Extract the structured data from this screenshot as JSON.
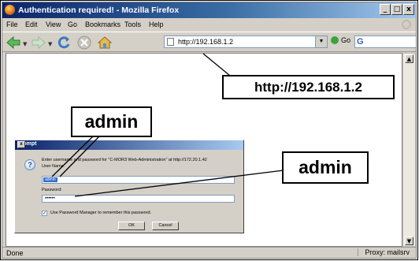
{
  "window": {
    "title": "Authentication required! - Mozilla Firefox",
    "controls": {
      "minimize": "_",
      "maximize": "□",
      "close": "x"
    }
  },
  "menu": [
    "File",
    "Edit",
    "View",
    "Go",
    "Bookmarks",
    "Tools",
    "Help"
  ],
  "toolbar": {
    "back_icon": "back-arrow-icon",
    "forward_icon": "forward-arrow-icon",
    "reload_icon": "reload-icon",
    "stop_icon": "stop-icon",
    "home_icon": "home-icon",
    "address": "http://192.168.1.2",
    "go_label": "Go",
    "search_engine_icon": "google-icon"
  },
  "status": {
    "left": "Done",
    "proxy": "Proxy: mailsrv"
  },
  "callouts": {
    "url": "http://192.168.1.2",
    "username": "admin",
    "password": "admin"
  },
  "dialog": {
    "title": "Prompt",
    "close": "x",
    "message": "Enter username and password for \"C-MOR3 Web-Administration\" at http://172.20.1.42",
    "username_label": "User Name:",
    "username_value": "admin",
    "password_label": "Password:",
    "password_value": "••••••",
    "remember_label": "Use Password Manager to remember this password.",
    "remember_checked": true,
    "ok_label": "OK",
    "cancel_label": "Cancel"
  },
  "colors": {
    "titlebar_start": "#0a246a",
    "titlebar_end": "#a6caf0",
    "chrome": "#d4d0c8",
    "selection": "#316ac5"
  }
}
